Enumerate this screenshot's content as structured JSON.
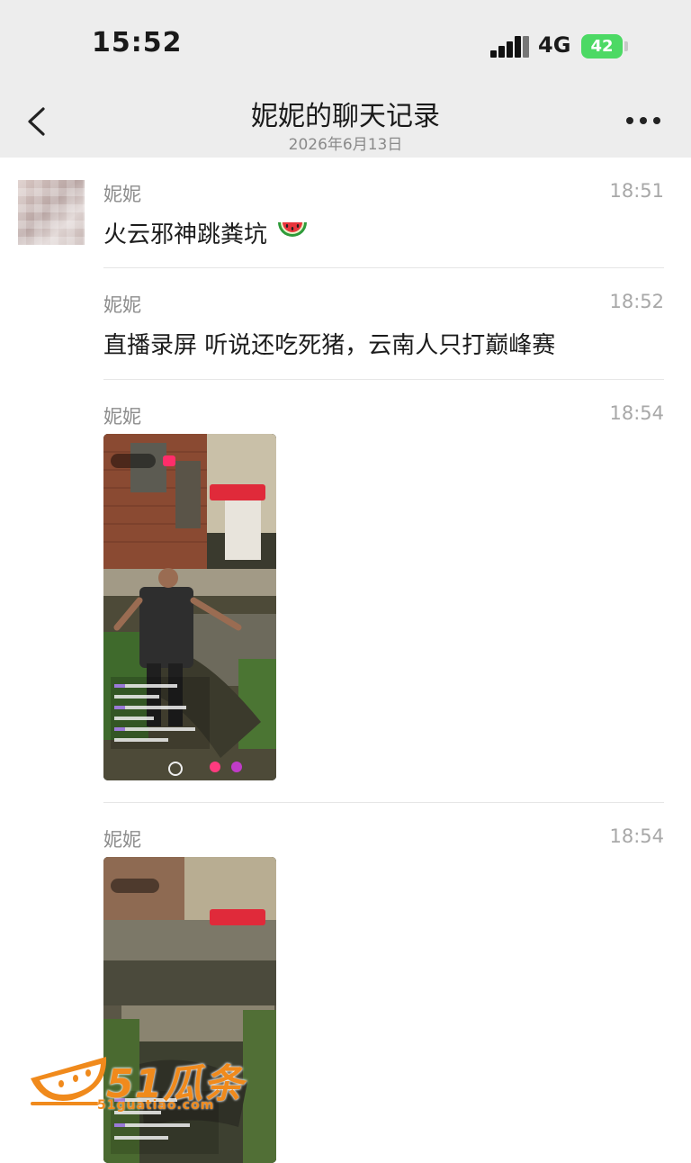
{
  "status_bar": {
    "time": "15:52",
    "network": "4G",
    "battery": "42"
  },
  "nav": {
    "title": "妮妮的聊天记录",
    "subtitle": "2026年6月13日"
  },
  "messages": [
    {
      "sender": "妮妮",
      "time": "18:51",
      "text": "火云邪神跳粪坑"
    },
    {
      "sender": "妮妮",
      "time": "18:52",
      "text": "直播录屏 听说还吃死猪，云南人只打巅峰赛"
    },
    {
      "sender": "妮妮",
      "time": "18:54",
      "media": "video"
    },
    {
      "sender": "妮妮",
      "time": "18:54",
      "media": "video"
    }
  ],
  "icons": [
    "back-icon",
    "more-icon",
    "signal-icon",
    "battery-icon",
    "watermelon-icon"
  ],
  "watermark": {
    "brand": "51瓜条",
    "url": "51guatiao.com"
  },
  "colors": {
    "header_bg": "#ededed",
    "battery": "#4cd964",
    "watermark": "#f08a1c"
  }
}
